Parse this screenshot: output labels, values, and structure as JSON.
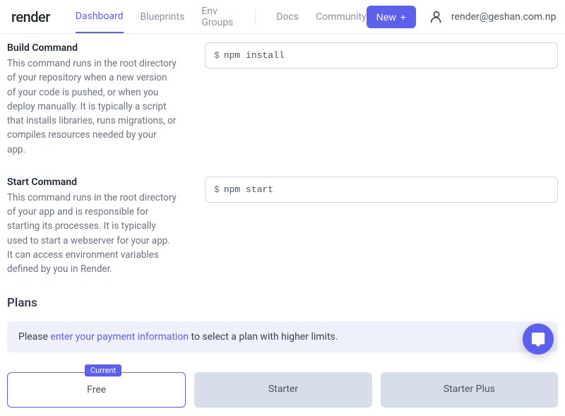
{
  "brand": "render",
  "nav": {
    "dashboard": "Dashboard",
    "blueprints": "Blueprints",
    "envgroups": "Env Groups",
    "docs": "Docs",
    "community": "Community"
  },
  "header": {
    "new_btn": "New",
    "user_email": "render@geshan.com.np"
  },
  "build": {
    "title": "Build Command",
    "desc": "This command runs in the root directory of your repository when a new version of your code is pushed, or when you deploy manually. It is typically a script that installs libraries, runs migrations, or compiles resources needed by your app.",
    "value": "npm install"
  },
  "start": {
    "title": "Start Command",
    "desc": "This command runs in the root directory of your app and is responsible for starting its processes. It is typically used to start a webserver for your app. It can access environment variables defined by you in Render.",
    "value": "npm start"
  },
  "plans": {
    "heading": "Plans",
    "notice_prefix": "Please ",
    "notice_link": "enter your payment information",
    "notice_suffix": " to select a plan with higher limits.",
    "current_badge": "Current",
    "options": {
      "free": "Free",
      "starter": "Starter",
      "starter_plus": "Starter Plus"
    }
  }
}
